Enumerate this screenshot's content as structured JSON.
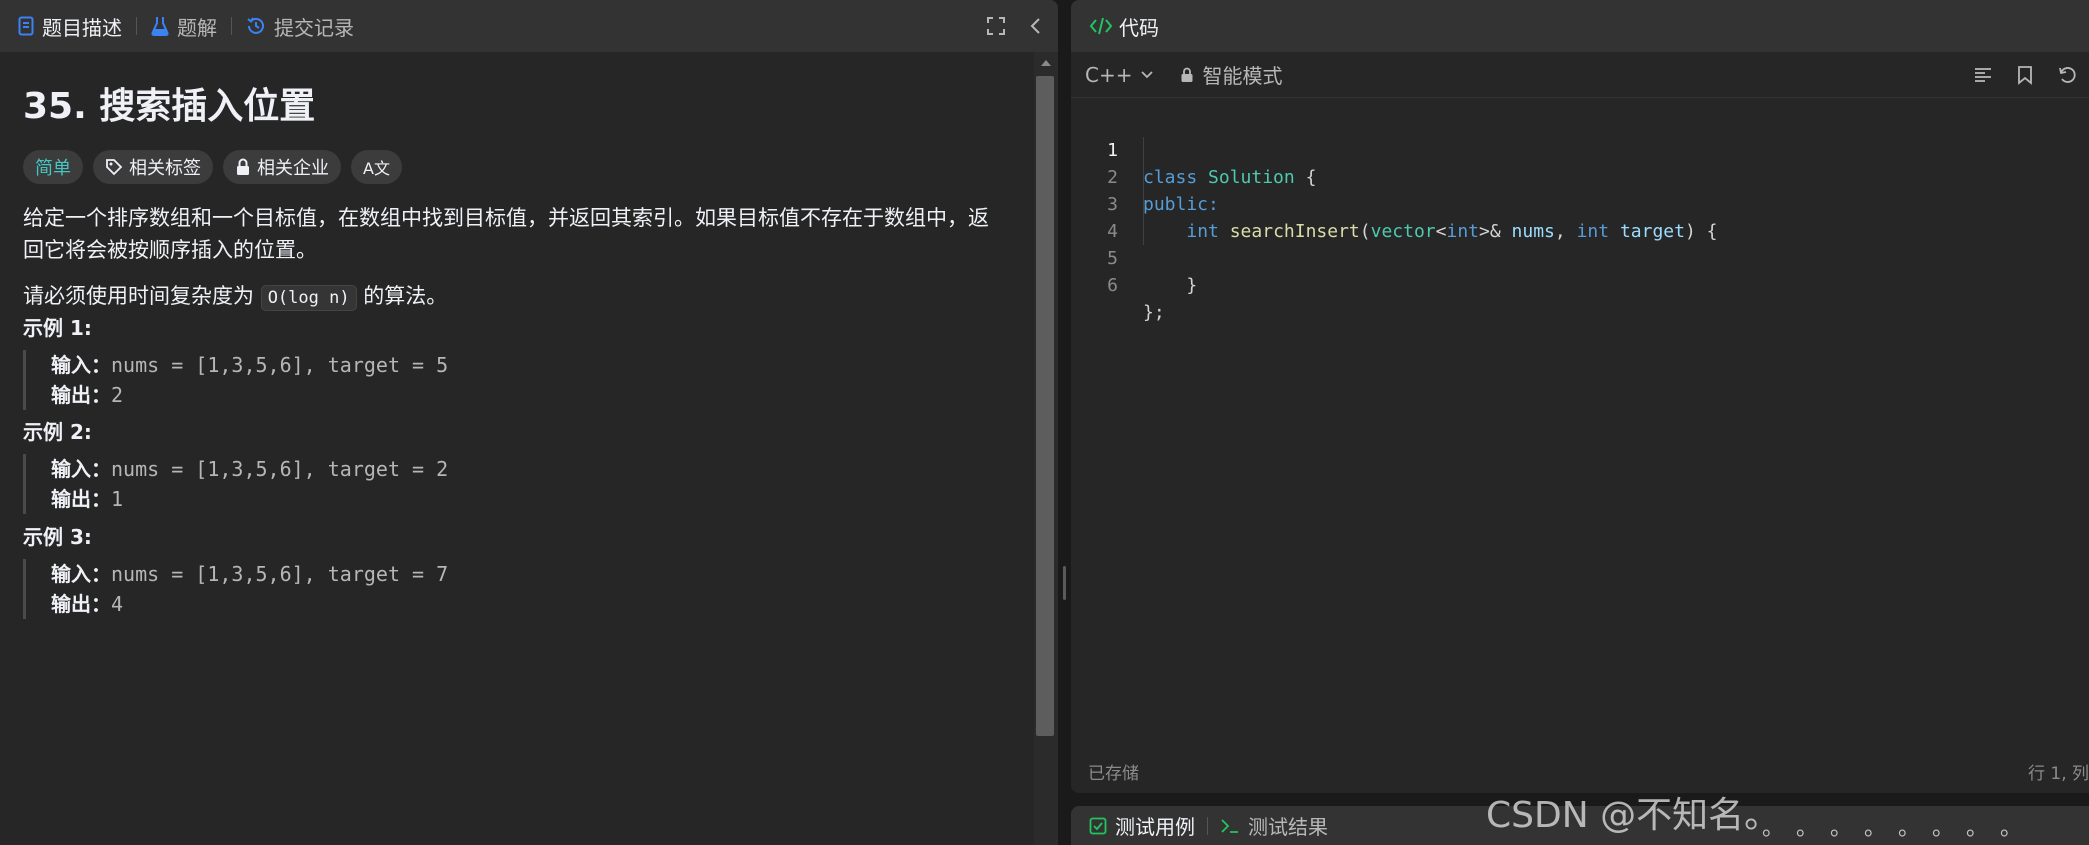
{
  "left_tabs": [
    {
      "label": "题目描述",
      "icon": "description-icon"
    },
    {
      "label": "题解",
      "icon": "flask-icon"
    },
    {
      "label": "提交记录",
      "icon": "history-icon"
    }
  ],
  "problem": {
    "title": "35. 搜索插入位置",
    "tags": {
      "difficulty": "简单",
      "related_tags": "相关标签",
      "related_companies": "相关企业",
      "translate": "A文"
    },
    "description_1": "给定一个排序数组和一个目标值，在数组中找到目标值，并返回其索引。如果目标值不存在于数组中，返回它将会被按顺序插入的位置。",
    "description_2_before": "请必须使用时间复杂度为",
    "description_2_code": "O(log n)",
    "description_2_after": "的算法。",
    "examples": [
      {
        "title": "示例 1:",
        "input_label": "输入：",
        "input": "nums = [1,3,5,6], target = 5",
        "output_label": "输出：",
        "output": "2"
      },
      {
        "title": "示例 2:",
        "input_label": "输入：",
        "input": "nums = [1,3,5,6], target = 2",
        "output_label": "输出：",
        "output": "1"
      },
      {
        "title": "示例 3:",
        "input_label": "输入：",
        "input": "nums = [1,3,5,6], target = 7",
        "output_label": "输出：",
        "output": "4"
      }
    ]
  },
  "code_panel": {
    "title": "代码",
    "language": "C++",
    "mode": "智能模式",
    "line_numbers": [
      "1",
      "2",
      "3",
      "4",
      "5",
      "6"
    ],
    "code": {
      "l1_kw": "class",
      "l1_name": "Solution",
      "l1_brace": "{",
      "l2_kw": "public:",
      "l3_type": "int",
      "l3_fn": "searchInsert",
      "l3_open": "(",
      "l3_vec": "vector",
      "l3_lt": "<",
      "l3_int": "int",
      "l3_gt": ">&",
      "l3_nums": "nums",
      "l3_comma": ", ",
      "l3_int2": "int",
      "l3_target": "target",
      "l3_close": ") {",
      "l5_brace": "}",
      "l6_end": "};"
    },
    "saved_status": "已存储",
    "cursor_position": "行 1, 列"
  },
  "bottom_tabs": [
    {
      "label": "测试用例",
      "icon": "checkbox-icon"
    },
    {
      "label": "测试结果",
      "icon": "terminal-icon"
    }
  ],
  "watermark": "CSDN @不知名。",
  "watermark_dots": "。。。。。。。。",
  "colors": {
    "accent_easy": "#46c6c2",
    "tab_description_icon": "#3b82f6",
    "code_icon": "#22c55e",
    "keyword": "#569cd6",
    "type": "#4ec9b0"
  }
}
